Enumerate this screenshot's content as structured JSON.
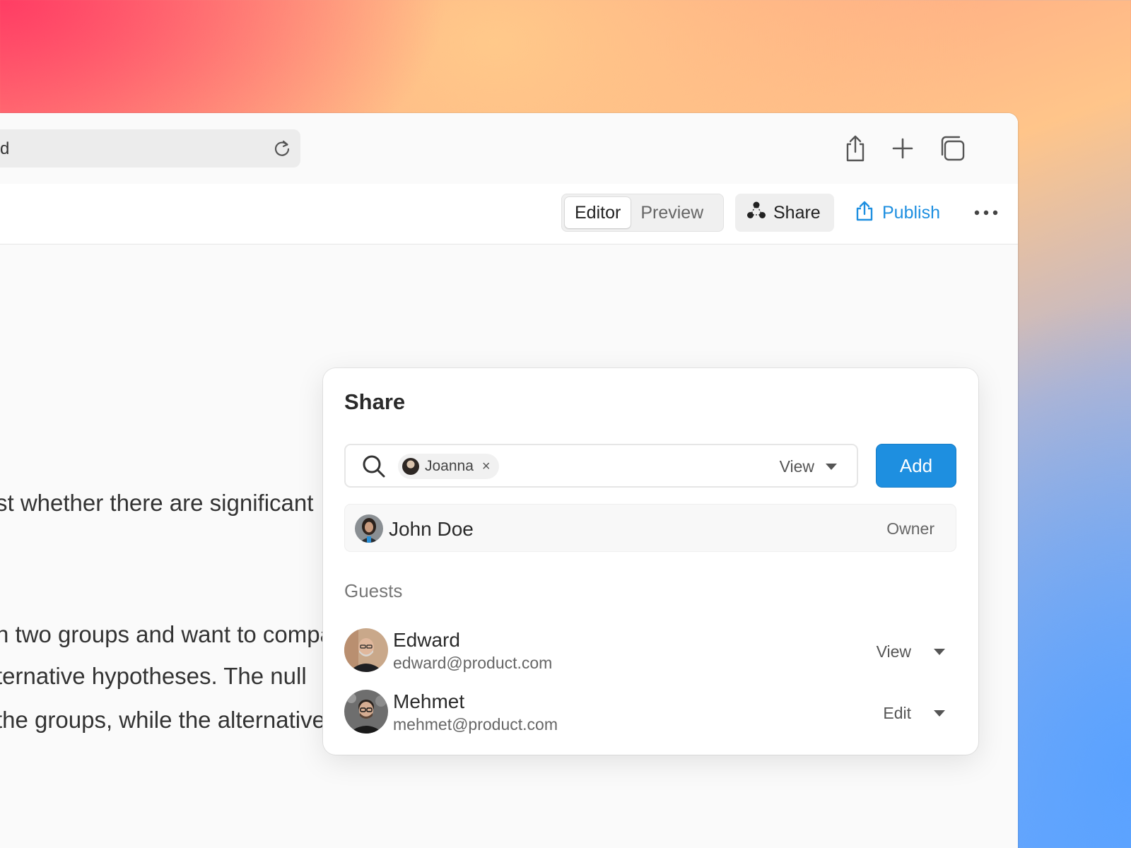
{
  "browser": {
    "address_text": "d",
    "icons": [
      "reload-icon",
      "share-icon",
      "plus-icon",
      "tabs-icon"
    ]
  },
  "toolbar": {
    "editor_label": "Editor",
    "preview_label": "Preview",
    "share_label": "Share",
    "publish_label": "Publish",
    "accent_color": "#1e8fe0"
  },
  "document": {
    "lines": [
      "st whether there are significant",
      "n two groups and want to compare",
      "ternative hypotheses. The null",
      "the groups, while the alternative"
    ]
  },
  "share_panel": {
    "title": "Share",
    "search": {
      "chip_name": "Joanna",
      "chip_remove": "×",
      "permission": "View"
    },
    "add_label": "Add",
    "owner": {
      "name": "John Doe",
      "role": "Owner"
    },
    "guests_label": "Guests",
    "guests": [
      {
        "name": "Edward",
        "email": "edward@product.com",
        "permission": "View"
      },
      {
        "name": "Mehmet",
        "email": "mehmet@product.com",
        "permission": "Edit"
      }
    ]
  }
}
